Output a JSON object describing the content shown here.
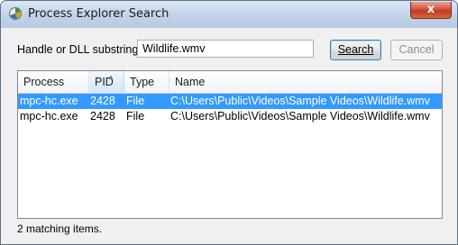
{
  "window": {
    "title": "Process Explorer Search",
    "close_symbol": "x"
  },
  "search": {
    "label": "Handle or DLL substring:",
    "value": "Wildlife.wmv"
  },
  "buttons": {
    "search_label": "Search",
    "cancel_label": "Cancel"
  },
  "table": {
    "columns": [
      "Process",
      "PID",
      "Type",
      "Name"
    ],
    "sorted_column": "PID",
    "rows": [
      {
        "process": "mpc-hc.exe",
        "pid": "2428",
        "type": "File",
        "name": "C:\\Users\\Public\\Videos\\Sample Videos\\Wildlife.wmv",
        "selected": true
      },
      {
        "process": "mpc-hc.exe",
        "pid": "2428",
        "type": "File",
        "name": "C:\\Users\\Public\\Videos\\Sample Videos\\Wildlife.wmv",
        "selected": false
      }
    ]
  },
  "status": {
    "text": "2 matching items."
  },
  "colors": {
    "selection": "#3399ff",
    "close_button": "#c43a22"
  }
}
